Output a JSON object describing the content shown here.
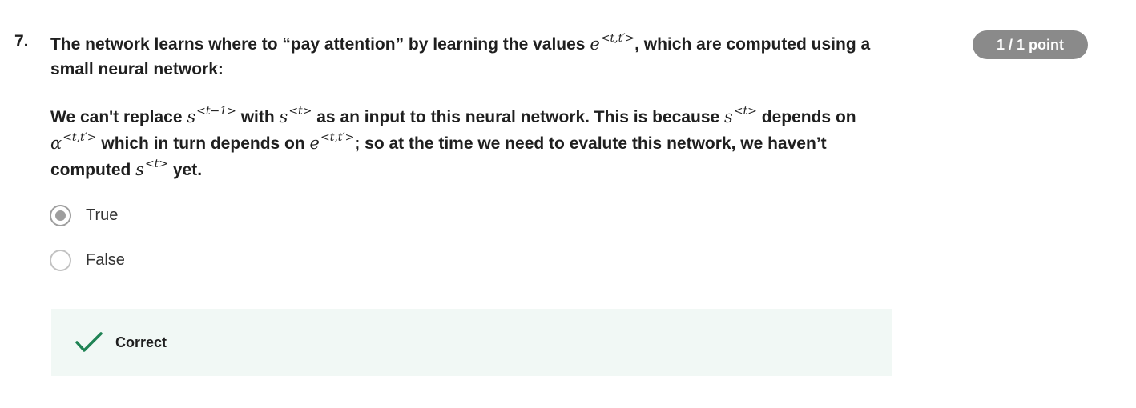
{
  "question": {
    "number": "7.",
    "points": "1 / 1 point",
    "line1_before": "The network learns where to “pay attention” by learning the values ",
    "math_e_base": "e",
    "math_e_sup": "<t,t′>",
    "line1_after": ", which are computed using a small neural network:",
    "stmt_p1": "We can't replace ",
    "math_s_prev_base": "s",
    "math_s_prev_sup": "<t−1>",
    "stmt_p2": " with ",
    "math_s_t_base": "s",
    "math_s_t_sup": "<t>",
    "stmt_p3": " as an input to this neural network. This is because ",
    "stmt_p4": " depends on ",
    "math_alpha_base": "α",
    "math_alpha_sup": "<t,t′>",
    "stmt_p5": " which in turn depends on ",
    "stmt_p6": "; so at the time we need to evalute this network, we haven’t computed ",
    "stmt_p7": " yet."
  },
  "options": [
    {
      "label": "True",
      "selected": true
    },
    {
      "label": "False",
      "selected": false
    }
  ],
  "feedback": {
    "status": "Correct",
    "icon": "check-icon",
    "color": "#1f8354"
  },
  "colors": {
    "badge_bg": "#8a8a8a",
    "feedback_bg": "#f1f8f5"
  }
}
